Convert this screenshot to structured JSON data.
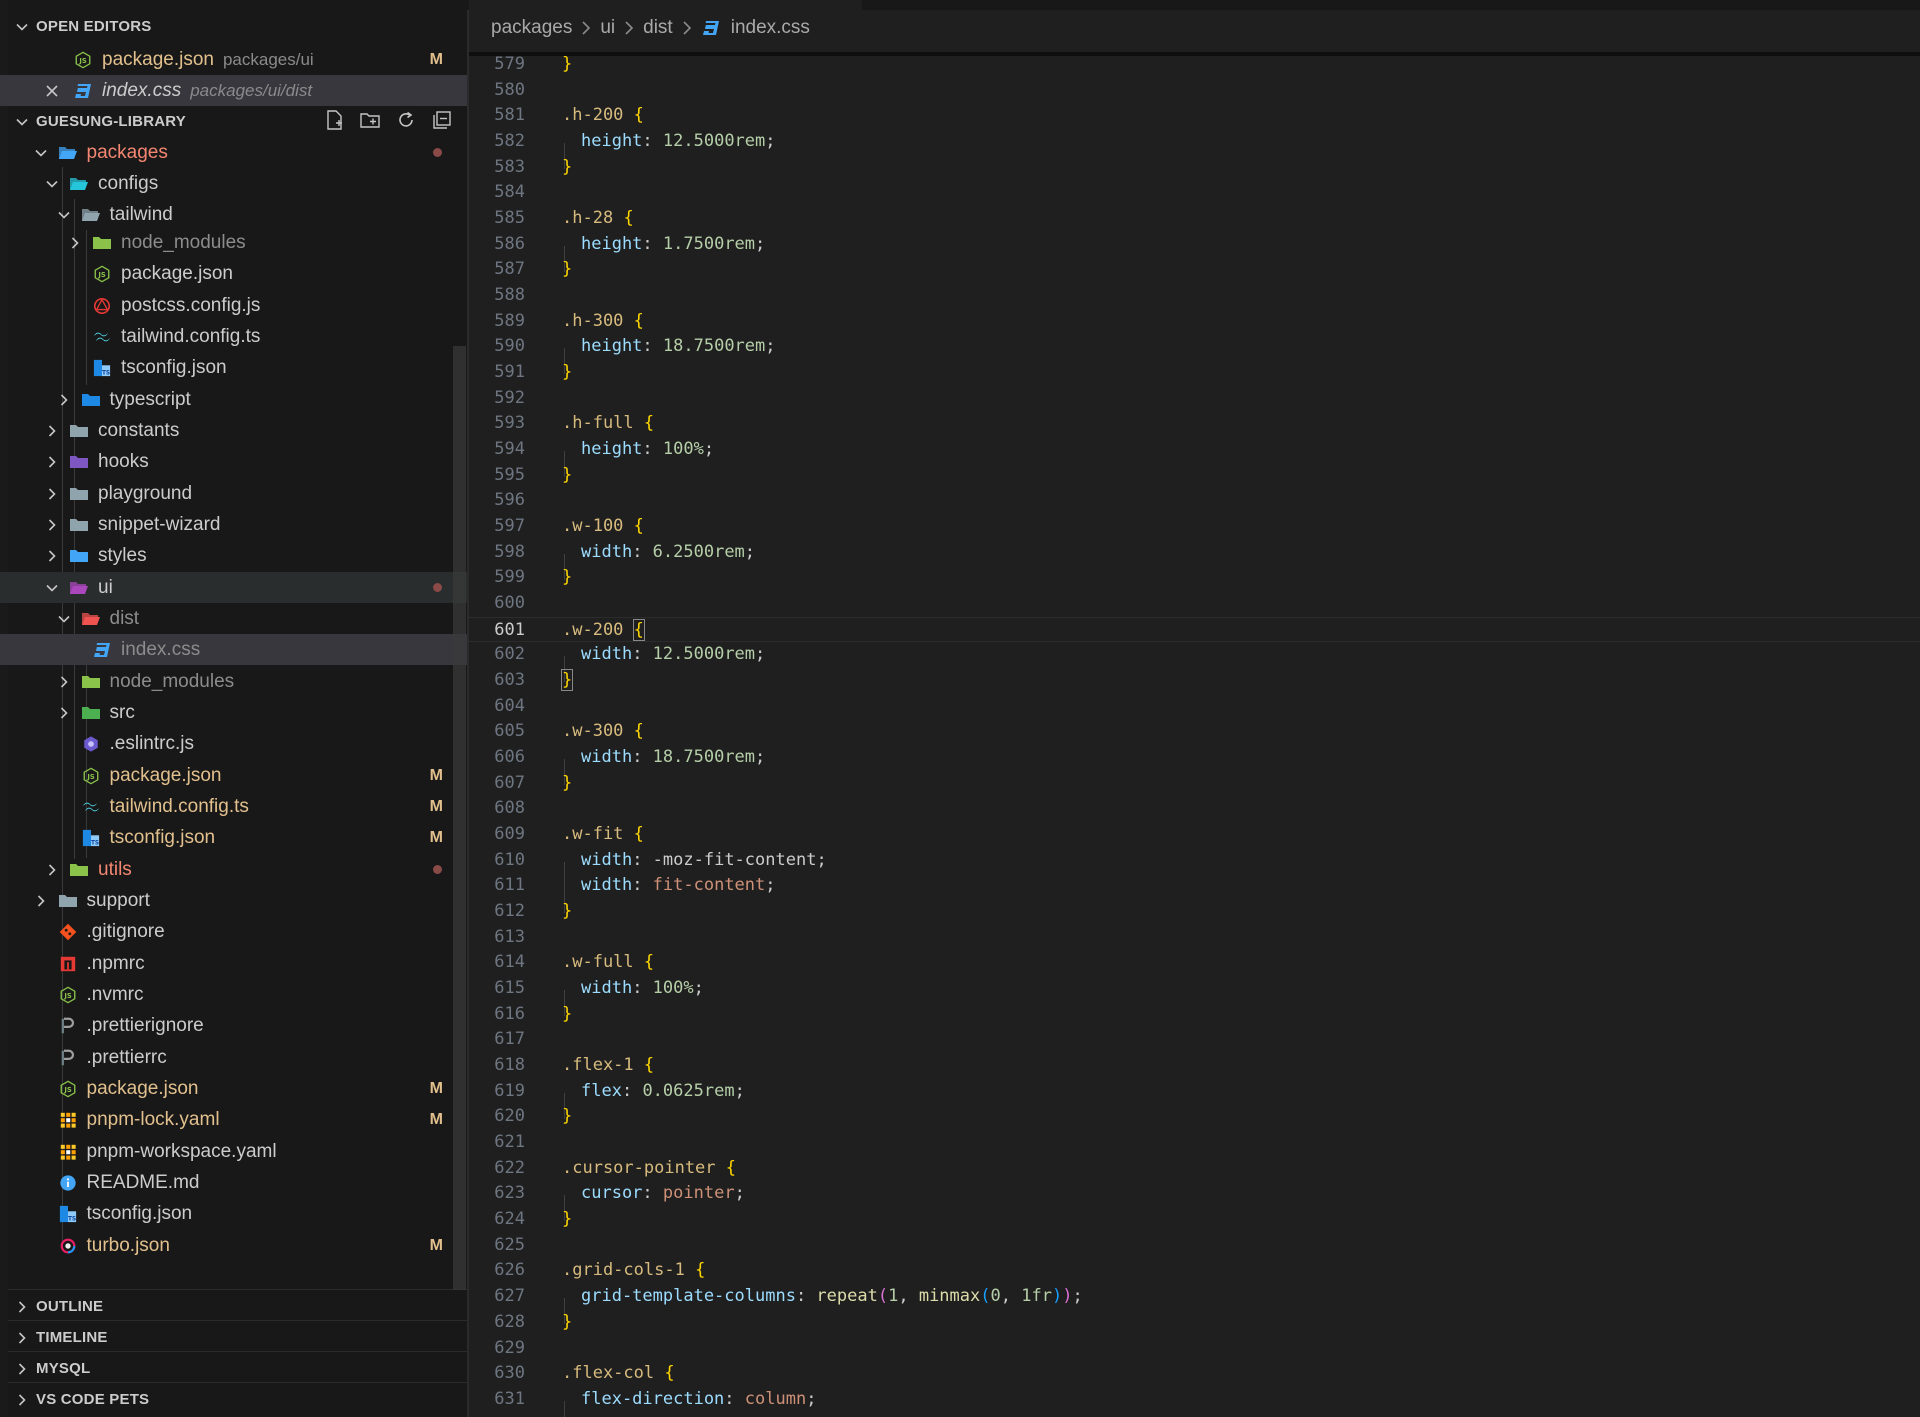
{
  "sidebar": {
    "open_editors": {
      "title": "OPEN EDITORS",
      "items": [
        {
          "label": "package.json",
          "desc": "packages/ui",
          "badge": "M"
        },
        {
          "label": "index.css",
          "desc": "packages/ui/dist"
        }
      ]
    },
    "workspace": {
      "title": "GUESUNG-LIBRARY",
      "tree": [
        {
          "label": "packages"
        },
        {
          "label": "configs"
        },
        {
          "label": "tailwind"
        },
        {
          "label": "node_modules"
        },
        {
          "label": "package.json"
        },
        {
          "label": "postcss.config.js"
        },
        {
          "label": "tailwind.config.ts"
        },
        {
          "label": "tsconfig.json"
        },
        {
          "label": "typescript"
        },
        {
          "label": "constants"
        },
        {
          "label": "hooks"
        },
        {
          "label": "playground"
        },
        {
          "label": "snippet-wizard"
        },
        {
          "label": "styles"
        },
        {
          "label": "ui"
        },
        {
          "label": "dist"
        },
        {
          "label": "index.css"
        },
        {
          "label": "node_modules"
        },
        {
          "label": "src"
        },
        {
          "label": ".eslintrc.js"
        },
        {
          "label": "package.json",
          "badge": "M"
        },
        {
          "label": "tailwind.config.ts",
          "badge": "M"
        },
        {
          "label": "tsconfig.json",
          "badge": "M"
        },
        {
          "label": "utils"
        },
        {
          "label": "support"
        },
        {
          "label": ".gitignore"
        },
        {
          "label": ".npmrc"
        },
        {
          "label": ".nvmrc"
        },
        {
          "label": ".prettierignore"
        },
        {
          "label": ".prettierrc"
        },
        {
          "label": "package.json",
          "badge": "M"
        },
        {
          "label": "pnpm-lock.yaml",
          "badge": "M"
        },
        {
          "label": "pnpm-workspace.yaml"
        },
        {
          "label": "README.md"
        },
        {
          "label": "tsconfig.json"
        },
        {
          "label": "turbo.json",
          "badge": "M"
        }
      ]
    },
    "bottom_sections": [
      {
        "title": "OUTLINE"
      },
      {
        "title": "TIMELINE"
      },
      {
        "title": "MYSQL"
      },
      {
        "title": "VS CODE PETS"
      }
    ]
  },
  "editor": {
    "breadcrumb": [
      "packages",
      "ui",
      "dist",
      "index.css"
    ],
    "current_line": 601,
    "lines": [
      {
        "n": "579",
        "t": "}"
      },
      {
        "n": "580",
        "t": ""
      },
      {
        "n": "581",
        "t": ".h-200 {"
      },
      {
        "n": "582",
        "t": "  height: 12.5000rem;"
      },
      {
        "n": "583",
        "t": "}"
      },
      {
        "n": "584",
        "t": ""
      },
      {
        "n": "585",
        "t": ".h-28 {"
      },
      {
        "n": "586",
        "t": "  height: 1.7500rem;"
      },
      {
        "n": "587",
        "t": "}"
      },
      {
        "n": "588",
        "t": ""
      },
      {
        "n": "589",
        "t": ".h-300 {"
      },
      {
        "n": "590",
        "t": "  height: 18.7500rem;"
      },
      {
        "n": "591",
        "t": "}"
      },
      {
        "n": "592",
        "t": ""
      },
      {
        "n": "593",
        "t": ".h-full {"
      },
      {
        "n": "594",
        "t": "  height: 100%;"
      },
      {
        "n": "595",
        "t": "}"
      },
      {
        "n": "596",
        "t": ""
      },
      {
        "n": "597",
        "t": ".w-100 {"
      },
      {
        "n": "598",
        "t": "  width: 6.2500rem;"
      },
      {
        "n": "599",
        "t": "}"
      },
      {
        "n": "600",
        "t": ""
      },
      {
        "n": "601",
        "t": ".w-200 {"
      },
      {
        "n": "602",
        "t": "  width: 12.5000rem;"
      },
      {
        "n": "603",
        "t": "}"
      },
      {
        "n": "604",
        "t": ""
      },
      {
        "n": "605",
        "t": ".w-300 {"
      },
      {
        "n": "606",
        "t": "  width: 18.7500rem;"
      },
      {
        "n": "607",
        "t": "}"
      },
      {
        "n": "608",
        "t": ""
      },
      {
        "n": "609",
        "t": ".w-fit {"
      },
      {
        "n": "610",
        "t": "  width: -moz-fit-content;"
      },
      {
        "n": "611",
        "t": "  width: fit-content;"
      },
      {
        "n": "612",
        "t": "}"
      },
      {
        "n": "613",
        "t": ""
      },
      {
        "n": "614",
        "t": ".w-full {"
      },
      {
        "n": "615",
        "t": "  width: 100%;"
      },
      {
        "n": "616",
        "t": "}"
      },
      {
        "n": "617",
        "t": ""
      },
      {
        "n": "618",
        "t": ".flex-1 {"
      },
      {
        "n": "619",
        "t": "  flex: 0.0625rem;"
      },
      {
        "n": "620",
        "t": "}"
      },
      {
        "n": "621",
        "t": ""
      },
      {
        "n": "622",
        "t": ".cursor-pointer {"
      },
      {
        "n": "623",
        "t": "  cursor: pointer;"
      },
      {
        "n": "624",
        "t": "}"
      },
      {
        "n": "625",
        "t": ""
      },
      {
        "n": "626",
        "t": ".grid-cols-1 {"
      },
      {
        "n": "627",
        "t": "  grid-template-columns: repeat(1, minmax(0, 1fr));"
      },
      {
        "n": "628",
        "t": "}"
      },
      {
        "n": "629",
        "t": ""
      },
      {
        "n": "630",
        "t": ".flex-col {"
      },
      {
        "n": "631",
        "t": "  flex-direction: column;"
      }
    ]
  },
  "colors": {
    "modified": "#e2c08d",
    "error": "#f48771",
    "selector": "#d7ba7d",
    "property": "#9cdcfe",
    "number": "#b5cea8",
    "keyword_value": "#ce9178",
    "brace": "#ffd700"
  }
}
